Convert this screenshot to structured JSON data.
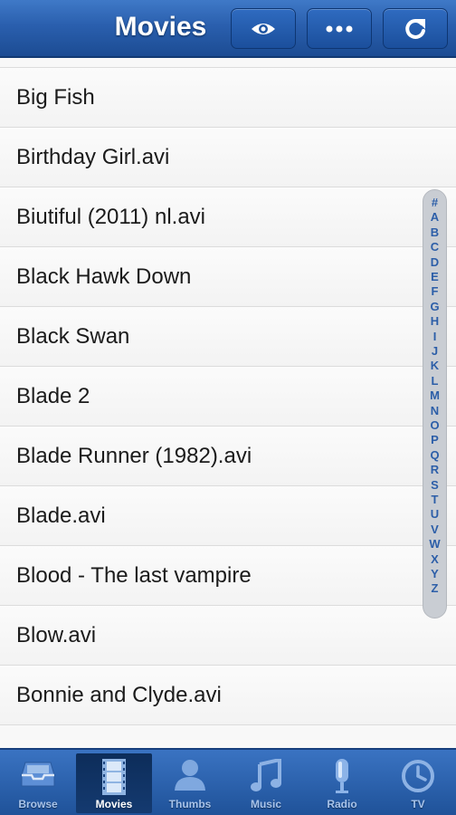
{
  "header": {
    "title": "Movies",
    "buttons": [
      {
        "icon": "eye-icon"
      },
      {
        "icon": "more-icon"
      },
      {
        "icon": "refresh-icon"
      }
    ]
  },
  "movies": [
    "Big Fish",
    "Birthday Girl.avi",
    "Biutiful (2011) nl.avi",
    "Black Hawk Down",
    "Black Swan",
    "Blade 2",
    "Blade Runner (1982).avi",
    "Blade.avi",
    "Blood - The last vampire",
    "Blow.avi",
    "Bonnie and Clyde.avi"
  ],
  "alphabet": [
    "#",
    "A",
    "B",
    "C",
    "D",
    "E",
    "F",
    "G",
    "H",
    "I",
    "J",
    "K",
    "L",
    "M",
    "N",
    "O",
    "P",
    "Q",
    "R",
    "S",
    "T",
    "U",
    "V",
    "W",
    "X",
    "Y",
    "Z"
  ],
  "tabs": [
    {
      "label": "Browse",
      "icon": "inbox-icon",
      "active": false
    },
    {
      "label": "Movies",
      "icon": "film-icon",
      "active": true
    },
    {
      "label": "Thumbs",
      "icon": "person-icon",
      "active": false
    },
    {
      "label": "Music",
      "icon": "music-note-icon",
      "active": false
    },
    {
      "label": "Radio",
      "icon": "microphone-icon",
      "active": false
    },
    {
      "label": "TV",
      "icon": "clock-icon",
      "active": false
    }
  ],
  "colors": {
    "header_blue": "#2a5fae",
    "alpha_letter": "#2c5ea8",
    "tab_active_label": "#ffffff",
    "tab_label": "#a9c4ea"
  }
}
